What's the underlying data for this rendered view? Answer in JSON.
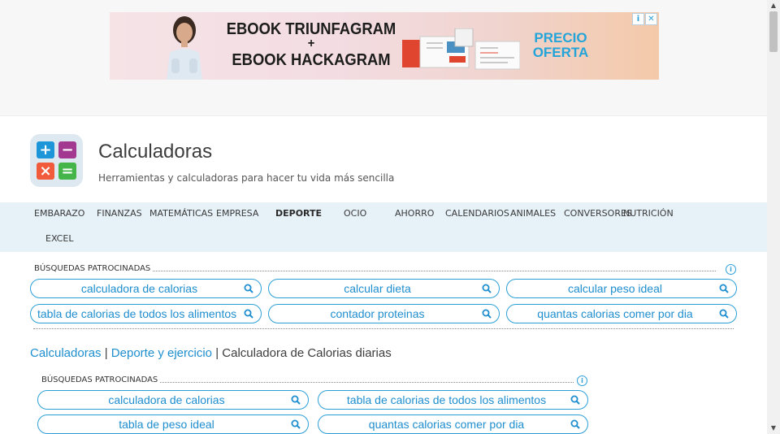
{
  "ad": {
    "headline_line1": "EBOOK TRIUNFAGRAM",
    "headline_plus": "+",
    "headline_line2": "EBOOK HACKAGRAM",
    "offer_line1": "PRECIO",
    "offer_line2": "OFERTA",
    "info_badge": "i",
    "close_badge": "✕"
  },
  "site": {
    "title": "Calculadoras",
    "tagline": "Herramientas y calculadoras para hacer tu vida más sencilla",
    "logo_symbols": [
      "+",
      "−",
      "×",
      "="
    ],
    "logo_colors": [
      "#1c95d9",
      "#a2388f",
      "#f15a3a",
      "#45b549"
    ]
  },
  "nav": {
    "items": [
      {
        "label": "EMBARAZO"
      },
      {
        "label": "FINANZAS"
      },
      {
        "label": "MATEMÁTICAS"
      },
      {
        "label": "EMPRESA"
      },
      {
        "label": "DEPORTE"
      },
      {
        "label": "OCIO"
      },
      {
        "label": "AHORRO"
      },
      {
        "label": "CALENDARIOS"
      },
      {
        "label": "ANIMALES"
      },
      {
        "label": "CONVERSORES"
      },
      {
        "label": "NUTRICIÓN"
      },
      {
        "label": "EXCEL"
      }
    ],
    "active": "DEPORTE"
  },
  "sponsored_top": {
    "label": "BÚSQUEDAS PATROCINADAS",
    "info": "i",
    "pills": [
      "calculadora de calorias",
      "calcular dieta",
      "calcular peso ideal",
      "tabla de calorias de todos los alimentos",
      "contador proteinas",
      "quantas calorias comer por dia"
    ]
  },
  "breadcrumb": {
    "items": [
      "Calculadoras",
      "Deporte y ejercicio",
      "Calculadora de Calorias diarias"
    ],
    "separator": "|"
  },
  "sponsored_bottom": {
    "label": "BÚSQUEDAS PATROCINADAS",
    "info": "i",
    "pills": [
      "calculadora de calorias",
      "tabla de calorias de todos los alimentos",
      "tabla de peso ideal",
      "quantas calorias comer por dia"
    ]
  },
  "colors": {
    "accent": "#2a9fd6",
    "nav_bg": "#e6f1f8",
    "offer": "#24a4d8"
  },
  "icons": {
    "search": "search-icon",
    "info": "info-icon",
    "close": "close-icon"
  }
}
